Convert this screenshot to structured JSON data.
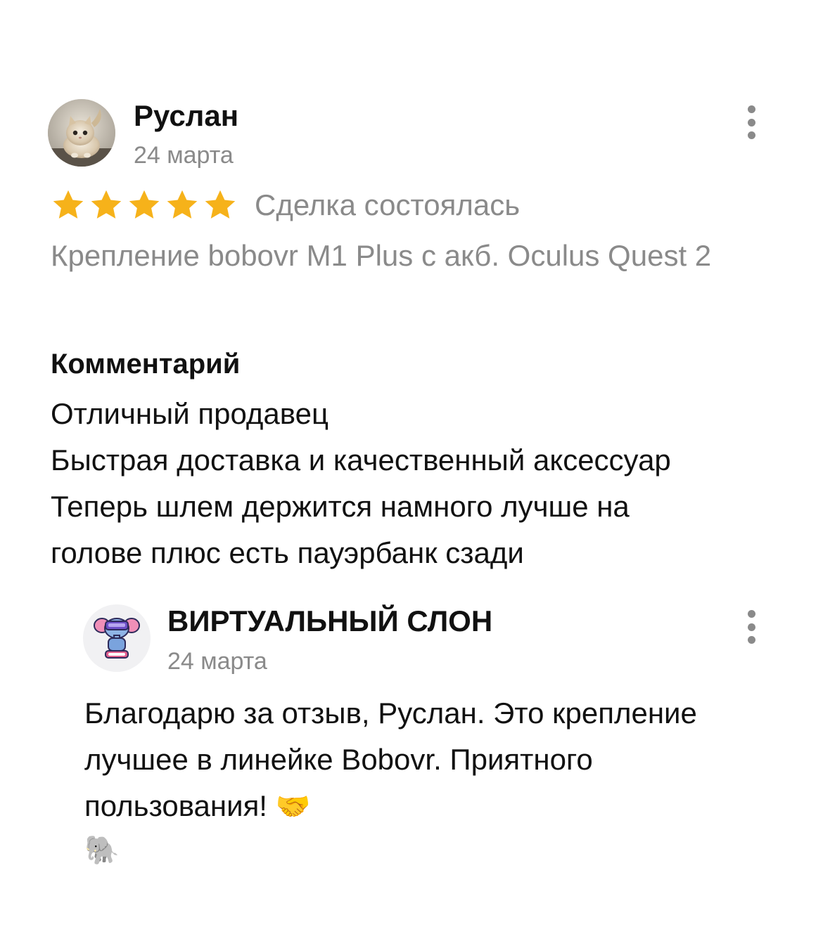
{
  "review": {
    "author_name": "Руслан",
    "author_date": "24 марта",
    "rating": 5,
    "rating_max": 5,
    "deal_status": "Сделка состоялась",
    "product_title": "Крепление bobovr M1 Plus с акб. Oculus Quest 2",
    "comment_heading": "Комментарий",
    "comment_lines": [
      "Отличный продавец",
      "Быстрая доставка и качественный аксессуар",
      "Теперь шлем держится намного лучше на",
      "голове плюс есть пауэрбанк сзади"
    ],
    "avatar_icon": "cat-avatar",
    "menu_icon": "more-vertical-icon"
  },
  "reply": {
    "seller_name": "ВИРТУАЛЬНЫЙ СЛОН",
    "seller_date": "24 марта",
    "avatar_icon": "vr-elephant-logo",
    "menu_icon": "more-vertical-icon",
    "text_lines": [
      "Благодарю за отзыв, Руслан. Это крепление",
      "лучшее в линейке Bobovr. Приятного",
      "пользования!"
    ],
    "emoji_handshake": "🤝",
    "emoji_elephant": "🐘"
  },
  "colors": {
    "star": "#f6b21a",
    "muted_text": "#8a8a8a",
    "main_text": "#111111",
    "background": "#ffffff"
  }
}
